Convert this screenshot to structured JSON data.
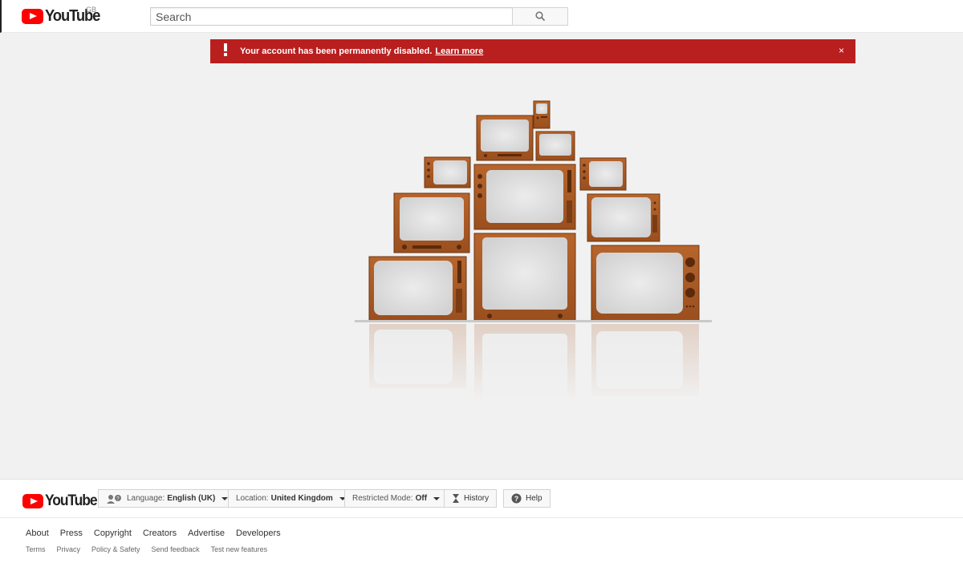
{
  "header": {
    "logo_text": "YouTube",
    "region": "GB",
    "search_placeholder": "Search"
  },
  "alert": {
    "message": "Your account has been permanently disabled.",
    "link": "Learn more",
    "close": "×",
    "color": "#b91f1f"
  },
  "footer": {
    "logo_text": "YouTube",
    "language": {
      "label": "Language:",
      "value": "English (UK)"
    },
    "location": {
      "label": "Location:",
      "value": "United Kingdom"
    },
    "restricted": {
      "label": "Restricted Mode:",
      "value": "Off"
    },
    "history": "History",
    "help": "Help",
    "primary_links": [
      "About",
      "Press",
      "Copyright",
      "Creators",
      "Advertise",
      "Developers"
    ],
    "secondary_links": [
      "Terms",
      "Privacy",
      "Policy & Safety",
      "Send feedback",
      "Test new features"
    ]
  },
  "colors": {
    "brand_red": "#ff0000",
    "tv_wood": "#a95a25",
    "screen_static": "#e2e2e2"
  },
  "icons": [
    "search-icon",
    "alert-exclamation-icon",
    "close-icon",
    "language-icon",
    "history-icon",
    "help-icon",
    "caret-down-icon"
  ]
}
